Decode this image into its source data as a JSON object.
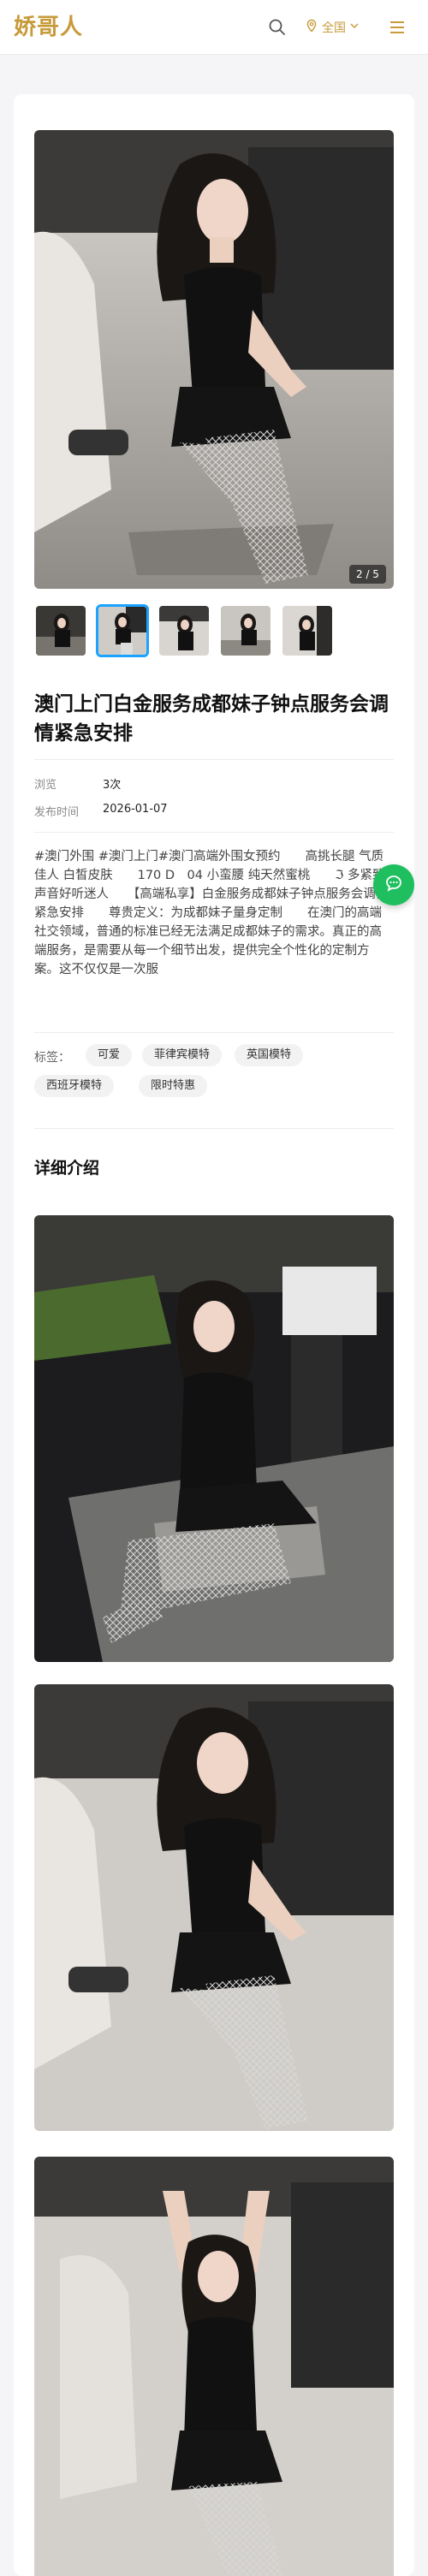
{
  "header": {
    "logo_text": "娇哥人",
    "city_label": "全国"
  },
  "gallery": {
    "counter": "2 / 5",
    "thumb_count": 5,
    "active_thumb": 2
  },
  "post": {
    "title": "澳门上门白金服务成都妹子钟点服务会调情紧急安排",
    "views_label": "浏览",
    "views_value": "3次",
    "date_label": "发布时间",
    "date_value": "2026-01-07",
    "description": "#澳门外围 #澳门上门#澳门高端外围女预约　　高挑长腿 气质佳人 白皙皮肤　　170 D　04 小蛮腰 纯天然蜜桃　　ℑ 多紧致 声音好听迷人　　【高端私享】白金服务成都妹子钟点服务会调情紧急安排　　尊贵定义：为成都妹子量身定制　　在澳门的高端社交领域，普通的标准已经无法满足成都妹子的需求。真正的高端服务，是需要从每一个细节出发，提供完全个性化的定制方案。这不仅仅是一次服"
  },
  "tags": {
    "label": "标签：",
    "items": [
      "可爱",
      "菲律宾模特",
      "英国模特",
      "西班牙模特",
      "限时特惠"
    ]
  },
  "details": {
    "section_title": "详细介绍"
  },
  "colors": {
    "brand_gold": "#c79a3a",
    "active_border": "#1aa3ff",
    "chat_green": "#1fbf5f"
  },
  "icons": [
    "search-icon",
    "location-pin-icon",
    "chevron-down-icon",
    "hamburger-menu-icon",
    "chat-bubble-icon"
  ]
}
